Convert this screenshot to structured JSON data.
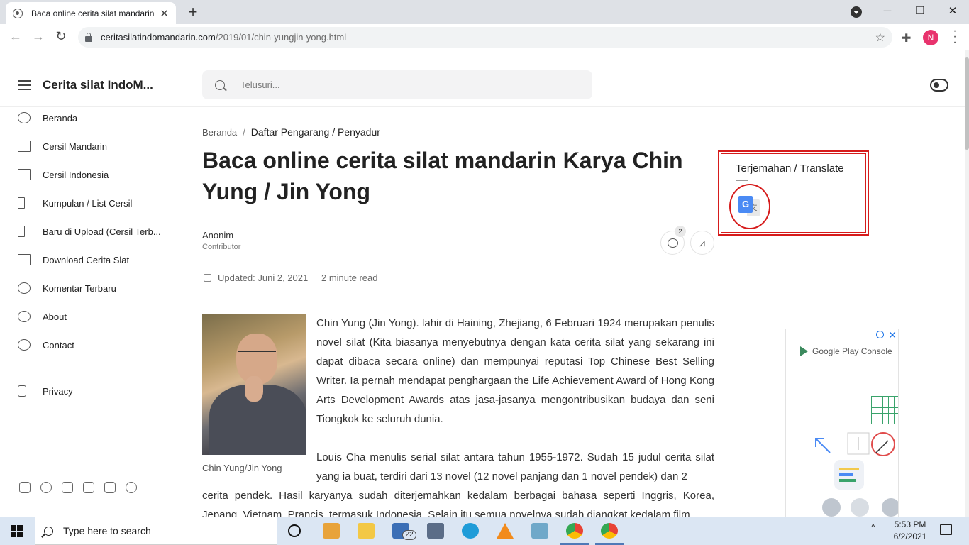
{
  "browser": {
    "tab_title": "Baca online cerita silat mandarin",
    "tab_close": "✕",
    "new_tab": "+",
    "url_host": "ceritasilatindomandarin.com",
    "url_path": "/2019/01/chin-yungjin-yong.html",
    "profile_initial": "N",
    "window_minimize": "─",
    "window_restore": "❐",
    "window_close": "✕"
  },
  "site": {
    "title": "Cerita silat IndoM...",
    "search_placeholder": "Telusuri..."
  },
  "nav": {
    "items": [
      {
        "label": "Beranda",
        "icon": "home-icon"
      },
      {
        "label": "Cersil Mandarin",
        "icon": "book-icon"
      },
      {
        "label": "Cersil Indonesia",
        "icon": "book-icon"
      },
      {
        "label": "Kumpulan / List Cersil",
        "icon": "list-icon"
      },
      {
        "label": "Baru di Upload (Cersil Terb...",
        "icon": "list-icon"
      },
      {
        "label": "Download Cerita Slat",
        "icon": "download-icon"
      },
      {
        "label": "Komentar Terbaru",
        "icon": "comment-icon"
      },
      {
        "label": "About",
        "icon": "people-icon"
      },
      {
        "label": "Contact",
        "icon": "mail-icon"
      },
      {
        "label": "Privacy",
        "icon": "lock-icon"
      }
    ],
    "socials": [
      "facebook-icon",
      "instagram-icon",
      "twitter-icon",
      "youtube-icon",
      "linkedin-icon",
      "pinterest-icon"
    ]
  },
  "article": {
    "breadcrumb_home": "Beranda",
    "breadcrumb_sep": "/",
    "breadcrumb_current": "Daftar Pengarang / Penyadur",
    "title": "Baca online cerita silat mandarin Karya Chin Yung / Jin Yong",
    "author": "Anonim",
    "author_role": "Contributor",
    "comment_count": "2",
    "updated": "Updated: Juni 2, 2021",
    "read_time": "2 minute read",
    "image_caption": "Chin Yung/Jin Yong",
    "paragraph1": "Chin Yung (Jin Yong). lahir di Haining, Zhejiang, 6 Februari 1924 merupakan penulis novel silat (Kita biasanya menyebutnya dengan kata cerita silat yang sekarang ini dapat dibaca secara online) dan mempunyai reputasi Top Chinese Best Selling Writer. Ia pernah mendapat penghargaan the Life Achievement Award of Hong Kong Arts Development Awards atas jasa-jasanya mengontribusikan budaya dan seni Tiongkok ke seluruh dunia.",
    "paragraph2a": "Louis Cha menulis serial silat antara tahun 1955-1972. Sudah 15 judul cerita silat yang ia buat, terdiri dari 13 novel (12 novel panjang dan 1 novel pendek) dan 2",
    "paragraph2b": "cerita pendek. Hasil karyanya sudah diterjemahkan kedalam berbagai bahasa seperti Inggris, Korea, Jepang, Vietnam, Prancis, termasuk Indonesia. Selain itu semua novelnya sudah diangkat kedalam film"
  },
  "widget": {
    "title": "Terjemahan / Translate",
    "icon": "google-translate-icon",
    "icon_letter": "G",
    "icon_glyph": "文"
  },
  "ad": {
    "brand": "Google Play Console",
    "close": "✕",
    "info": "i"
  },
  "taskbar": {
    "search_placeholder": "Type here to search",
    "mail_badge": "22",
    "time": "5:53 PM",
    "date": "6/2/2021",
    "tray_chevron": "^"
  },
  "colors": {
    "accent_red": "#d61b1b",
    "profile_pink": "#e8336d",
    "taskbar": "#dbe6f3"
  }
}
